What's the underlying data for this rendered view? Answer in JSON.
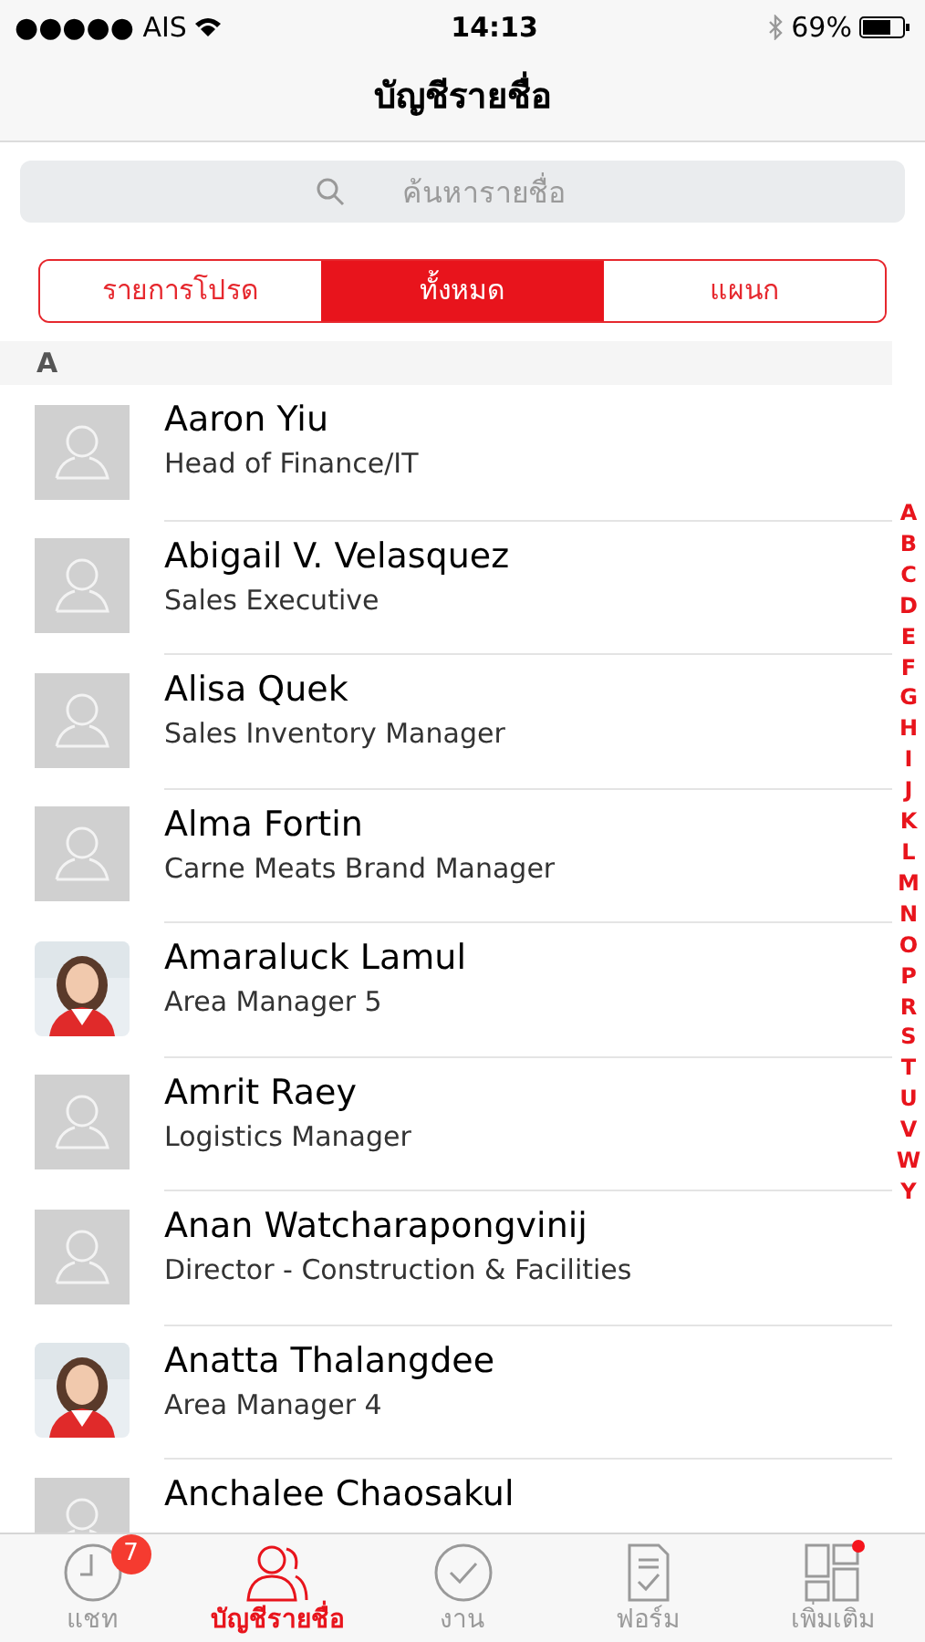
{
  "status_bar": {
    "carrier": "●●●●● AIS",
    "time": "14:13",
    "battery": "69%"
  },
  "nav": {
    "title": "บัญชีรายชื่อ"
  },
  "search": {
    "placeholder": "ค้นหารายชื่อ"
  },
  "segments": [
    {
      "label": "รายการโปรด",
      "selected": false
    },
    {
      "label": "ทั้งหมด",
      "selected": true
    },
    {
      "label": "แผนก",
      "selected": false
    }
  ],
  "section": {
    "header": "A"
  },
  "contacts": [
    {
      "name": "Aaron Yiu",
      "title": "Head of Finance/IT",
      "kind": "placeholder"
    },
    {
      "name": "Abigail V. Velasquez",
      "title": "Sales Executive",
      "kind": "placeholder"
    },
    {
      "name": "Alisa Quek",
      "title": "Sales Inventory Manager",
      "kind": "placeholder"
    },
    {
      "name": "Alma Fortin",
      "title": "Carne Meats Brand Manager",
      "kind": "placeholder"
    },
    {
      "name": "Amaraluck Lamul",
      "title": "Area Manager 5"
    },
    {
      "name": "Amrit Raey",
      "title": "Logistics Manager",
      "kind": "placeholder"
    },
    {
      "name": "Anan Watcharapongvinij",
      "title": "Director - Construction & Facilities",
      "kind": "placeholder"
    },
    {
      "name": "Anatta Thalangdee",
      "title": "Area Manager 4"
    },
    {
      "name": "Anchalee Chaosakul",
      "kind": "placeholder"
    }
  ],
  "index": [
    "A",
    "B",
    "C",
    "D",
    "E",
    "F",
    "G",
    "H",
    "I",
    "J",
    "K",
    "L",
    "M",
    "N",
    "O",
    "P",
    "R",
    "S",
    "T",
    "U",
    "V",
    "W",
    "Y"
  ],
  "tab_bar": [
    {
      "label": "แชท",
      "kind": "clock",
      "selected": false,
      "badge": "7"
    },
    {
      "label": "บัญชีรายชื่อ",
      "kind": "people",
      "selected": true
    },
    {
      "label": "งาน",
      "kind": "check",
      "selected": false
    },
    {
      "label": "ฟอร์ม",
      "kind": "form",
      "selected": false
    },
    {
      "label": "เพิ่มเติม",
      "kind": "grid",
      "selected": false,
      "dot": true
    }
  ]
}
